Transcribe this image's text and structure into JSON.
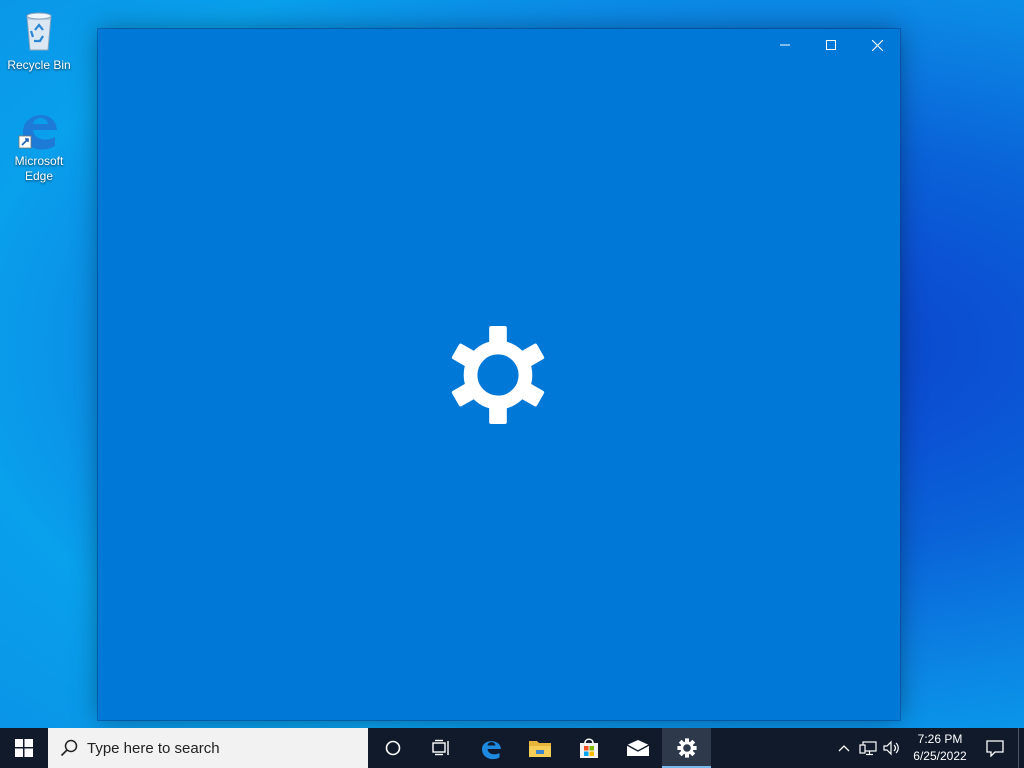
{
  "desktop": {
    "icons": [
      {
        "label": "Recycle Bin"
      },
      {
        "label": "Microsoft\nEdge"
      }
    ]
  },
  "window": {
    "state": "loading",
    "controls": {
      "minimize": "minimize-icon",
      "maximize": "maximize-icon",
      "close": "close-icon"
    },
    "splash_icon": "gear-icon",
    "background_color": "#0078d7"
  },
  "taskbar": {
    "search_placeholder": "Type here to search",
    "pinned": [
      "cortana-icon",
      "task-view-icon",
      "edge-icon",
      "file-explorer-icon",
      "store-icon",
      "mail-icon",
      "settings-icon"
    ],
    "active_app": "settings-icon",
    "clock": {
      "time": "7:26 PM",
      "date": "6/25/2022"
    },
    "background_color": "#101a2a"
  }
}
